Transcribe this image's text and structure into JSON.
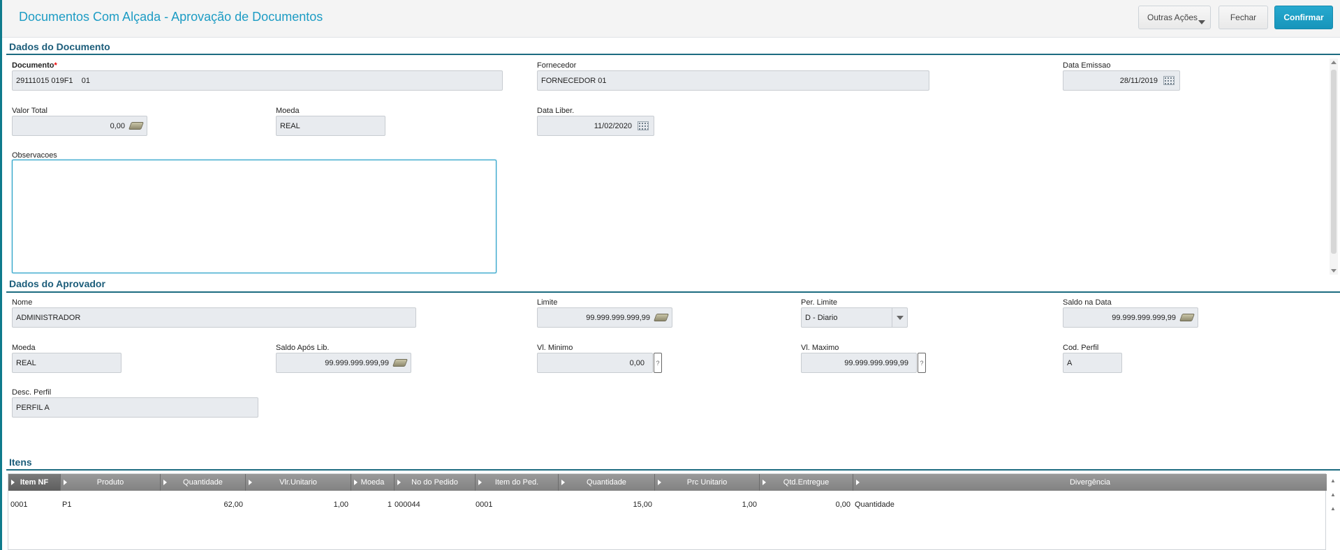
{
  "header": {
    "title": "Documentos Com Alçada - Aprovação de Documentos",
    "btn_outras": "Outras Ações",
    "btn_fechar": "Fechar",
    "btn_confirmar": "Confirmar"
  },
  "doc": {
    "section_title": "Dados do Documento",
    "documento_label": "Documento",
    "documento_required": "*",
    "documento_value": "29111015 019F1    01",
    "fornecedor_label": "Fornecedor",
    "fornecedor_value": "FORNECEDOR 01",
    "data_emissao_label": "Data Emissao",
    "data_emissao_value": "28/11/2019",
    "valor_total_label": "Valor Total",
    "valor_total_value": "0,00",
    "moeda_label": "Moeda",
    "moeda_value": "REAL",
    "data_liber_label": "Data Liber.",
    "data_liber_value": "11/02/2020",
    "observacoes_label": "Observacoes"
  },
  "aprovador": {
    "section_title": "Dados do Aprovador",
    "nome_label": "Nome",
    "nome_value": "ADMINISTRADOR",
    "limite_label": "Limite",
    "limite_value": "99.999.999.999,99",
    "per_limite_label": "Per. Limite",
    "per_limite_value": "D - Diario",
    "saldo_data_label": "Saldo na Data",
    "saldo_data_value": "99.999.999.999,99",
    "moeda_label": "Moeda",
    "moeda_value": "REAL",
    "saldo_apos_label": "Saldo Após Lib.",
    "saldo_apos_value": "99.999.999.999,99",
    "vl_minimo_label": "Vl. Minimo",
    "vl_minimo_value": "0,00",
    "vl_maximo_label": "Vl. Maximo",
    "vl_maximo_value": "99.999.999.999,99",
    "cod_perfil_label": "Cod. Perfil",
    "cod_perfil_value": "A",
    "desc_perfil_label": "Desc. Perfil",
    "desc_perfil_value": "PERFIL A",
    "help_glyph": "?"
  },
  "itens": {
    "section_title": "Itens",
    "columns": [
      "Item NF",
      "Produto",
      "Quantidade",
      "Vlr.Unitario",
      "Moeda",
      "No do Pedido",
      "Item do Ped.",
      "Quantidade",
      "Prc Unitario",
      "Qtd.Entregue",
      "Divergência"
    ],
    "rows": [
      [
        "0001",
        "P1",
        "62,00",
        "1,00",
        "1",
        "000044",
        "0001",
        "15,00",
        "1,00",
        "0,00",
        "Quantidade"
      ]
    ]
  }
}
